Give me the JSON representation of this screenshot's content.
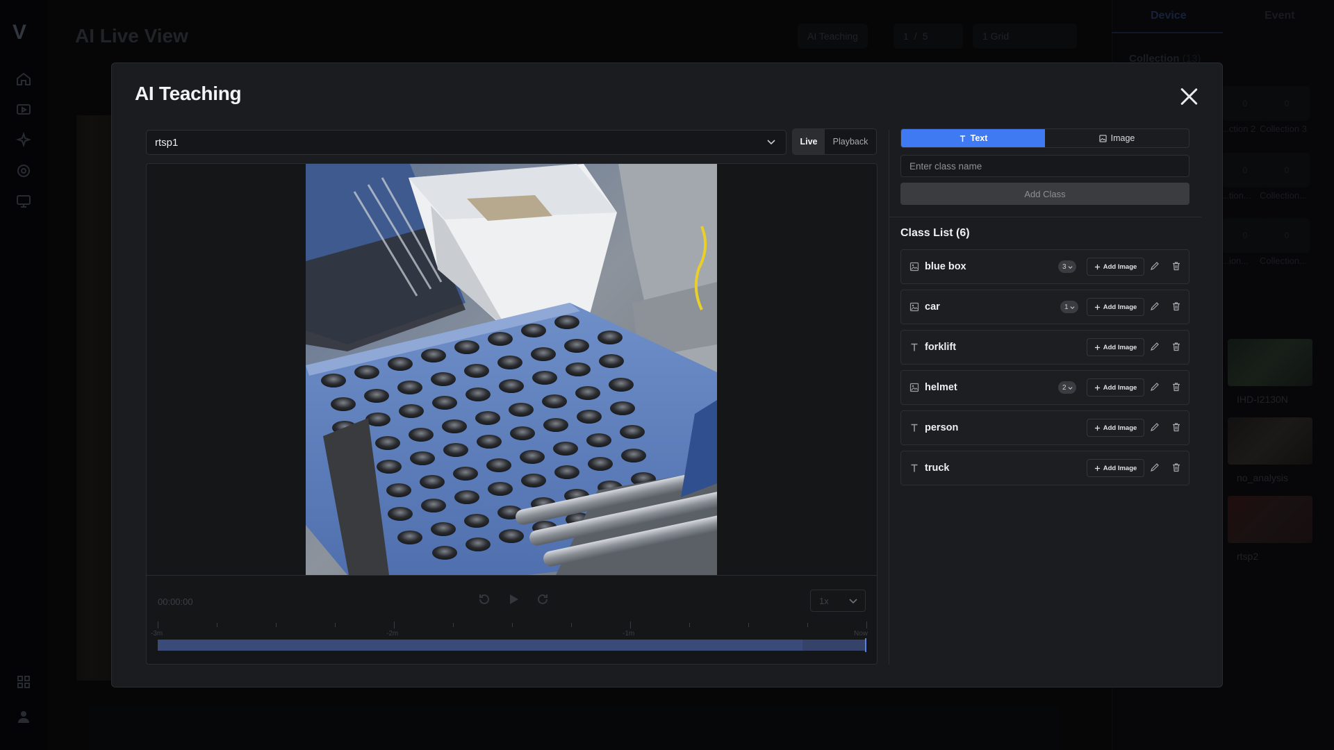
{
  "background": {
    "page_title": "AI Live View",
    "toolbar": {
      "ai_teaching": "AI Teaching",
      "page_current": "1",
      "page_sep": "/",
      "page_total": "5",
      "grid": "1 Grid"
    },
    "right_tabs": [
      "Device",
      "Event"
    ],
    "collection_title": "Collection",
    "collection_count": "(13)",
    "collections": [
      {
        "label": "...ction 2",
        "count": "0"
      },
      {
        "label": "Collection 3",
        "count": "0"
      },
      {
        "label": "...tion...",
        "count": "0"
      },
      {
        "label": "Collection...",
        "count": "0"
      },
      {
        "label": "...ion...",
        "count": "0"
      },
      {
        "label": "Collection...",
        "count": "0"
      }
    ],
    "cameras": [
      "IHD-I2130N",
      "no_analysis",
      "rtsp2"
    ]
  },
  "modal": {
    "title": "AI Teaching",
    "source": {
      "selected": "rtsp1"
    },
    "modes": {
      "live": "Live",
      "playback": "Playback"
    },
    "timeline": {
      "timecode": "00:00:00",
      "speed": "1x",
      "labels": [
        "-3m",
        "-2m",
        "-1m",
        "Now"
      ]
    },
    "tabs": {
      "text": "Text",
      "image": "Image"
    },
    "class_input": {
      "placeholder": "Enter class name",
      "value": ""
    },
    "add_class": "Add Class",
    "class_list_title": "Class List (6)",
    "add_image_label": "Add Image",
    "classes": [
      {
        "name": "blue box",
        "icon": "image-icon",
        "count": "3"
      },
      {
        "name": "car",
        "icon": "image-icon",
        "count": "1"
      },
      {
        "name": "forklift",
        "icon": "text-icon",
        "count": null
      },
      {
        "name": "helmet",
        "icon": "image-icon",
        "count": "2"
      },
      {
        "name": "person",
        "icon": "text-icon",
        "count": null
      },
      {
        "name": "truck",
        "icon": "text-icon",
        "count": null
      }
    ]
  },
  "colors": {
    "accent": "#3f7af2",
    "modal_bg": "#1b1c1f",
    "timeline_track": "#3a4a79"
  }
}
